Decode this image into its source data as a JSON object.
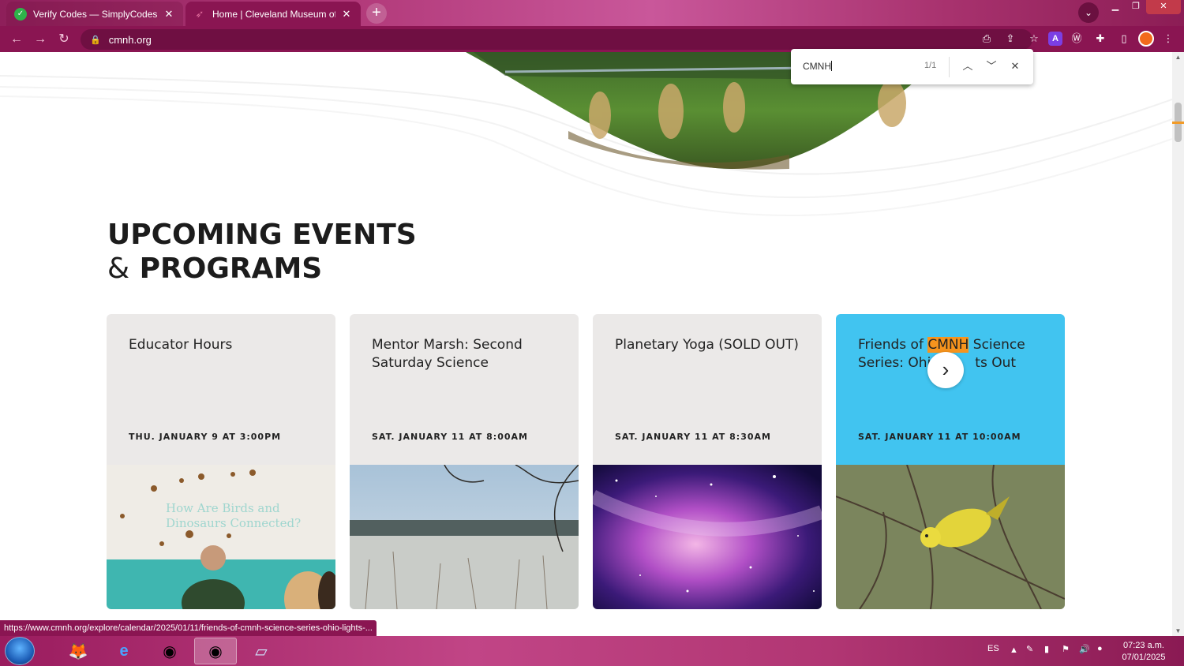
{
  "browser": {
    "tabs": [
      {
        "title": "Verify Codes — SimplyCodes",
        "active": false
      },
      {
        "title": "Home | Cleveland Museum of Na",
        "active": true
      }
    ],
    "url": "cmnh.org",
    "find": {
      "query": "CMNH",
      "count": "1/1"
    },
    "status_url": "https://www.cmnh.org/explore/calendar/2025/01/11/friends-of-cmnh-science-series-ohio-lights-..."
  },
  "page": {
    "heading_line1": "UPCOMING EVENTS",
    "heading_amp": "&",
    "heading_line2": "PROGRAMS",
    "events": [
      {
        "title": "Educator Hours",
        "date": "THU. JANUARY 9 AT 3:00PM",
        "image": "birds-dinosaurs-classroom",
        "image_text_1": "How Are Birds and",
        "image_text_2": "Dinosaurs Connected?"
      },
      {
        "title": "Mentor Marsh: Second Saturday Science",
        "date": "SAT. JANUARY 11 AT 8:00AM",
        "image": "snowy-marsh"
      },
      {
        "title": "Planetary Yoga (SOLD OUT)",
        "date": "SAT. JANUARY 11 AT 8:30AM",
        "image": "galaxy"
      },
      {
        "title_pre": "Friends of ",
        "title_highlight": "CMNH",
        "title_post": " Science",
        "title_line2": "Series: Ohio Lights Out",
        "title_line2_a": "Series: Ohi",
        "title_line2_b": "ts Out",
        "date": "SAT. JANUARY 11 AT 10:00AM",
        "image": "yellow-warbler"
      }
    ]
  },
  "taskbar": {
    "language": "ES",
    "time": "07:23 a.m.",
    "date": "07/01/2025"
  },
  "colors": {
    "browser_frame": "#8a1552",
    "card_bg": "#ebe9e8",
    "card_highlight": "#41c4f0",
    "find_highlight": "#f7941d"
  }
}
